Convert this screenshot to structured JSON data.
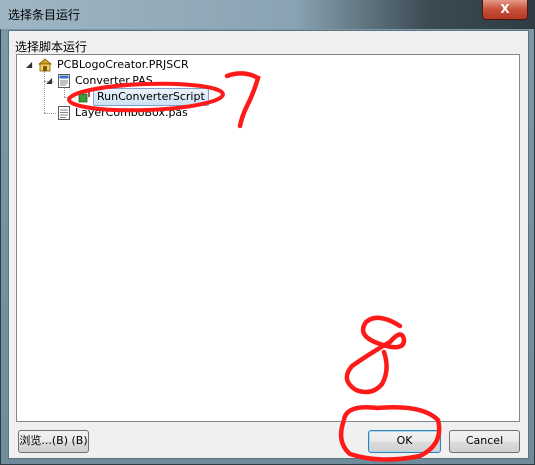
{
  "window": {
    "title": "选择条目运行",
    "close_label": "X"
  },
  "group": {
    "label": "选择脚本运行"
  },
  "tree": {
    "root": {
      "label": "PCBLogoCreator.PRJSCR",
      "icon": "project-icon",
      "expanded": true
    },
    "children": [
      {
        "label": "Converter.PAS",
        "icon": "pascal-file-icon",
        "expanded": true,
        "children": [
          {
            "label": "RunConverterScript",
            "icon": "procedure-icon",
            "selected": true
          }
        ]
      },
      {
        "label": "LayerComboBox.pas",
        "icon": "document-icon"
      }
    ]
  },
  "buttons": {
    "browse": "浏览...(B) (B)",
    "ok": "OK",
    "cancel": "Cancel"
  },
  "annotations": {
    "step7": "7",
    "step8": "8",
    "color": "#ff0000"
  }
}
